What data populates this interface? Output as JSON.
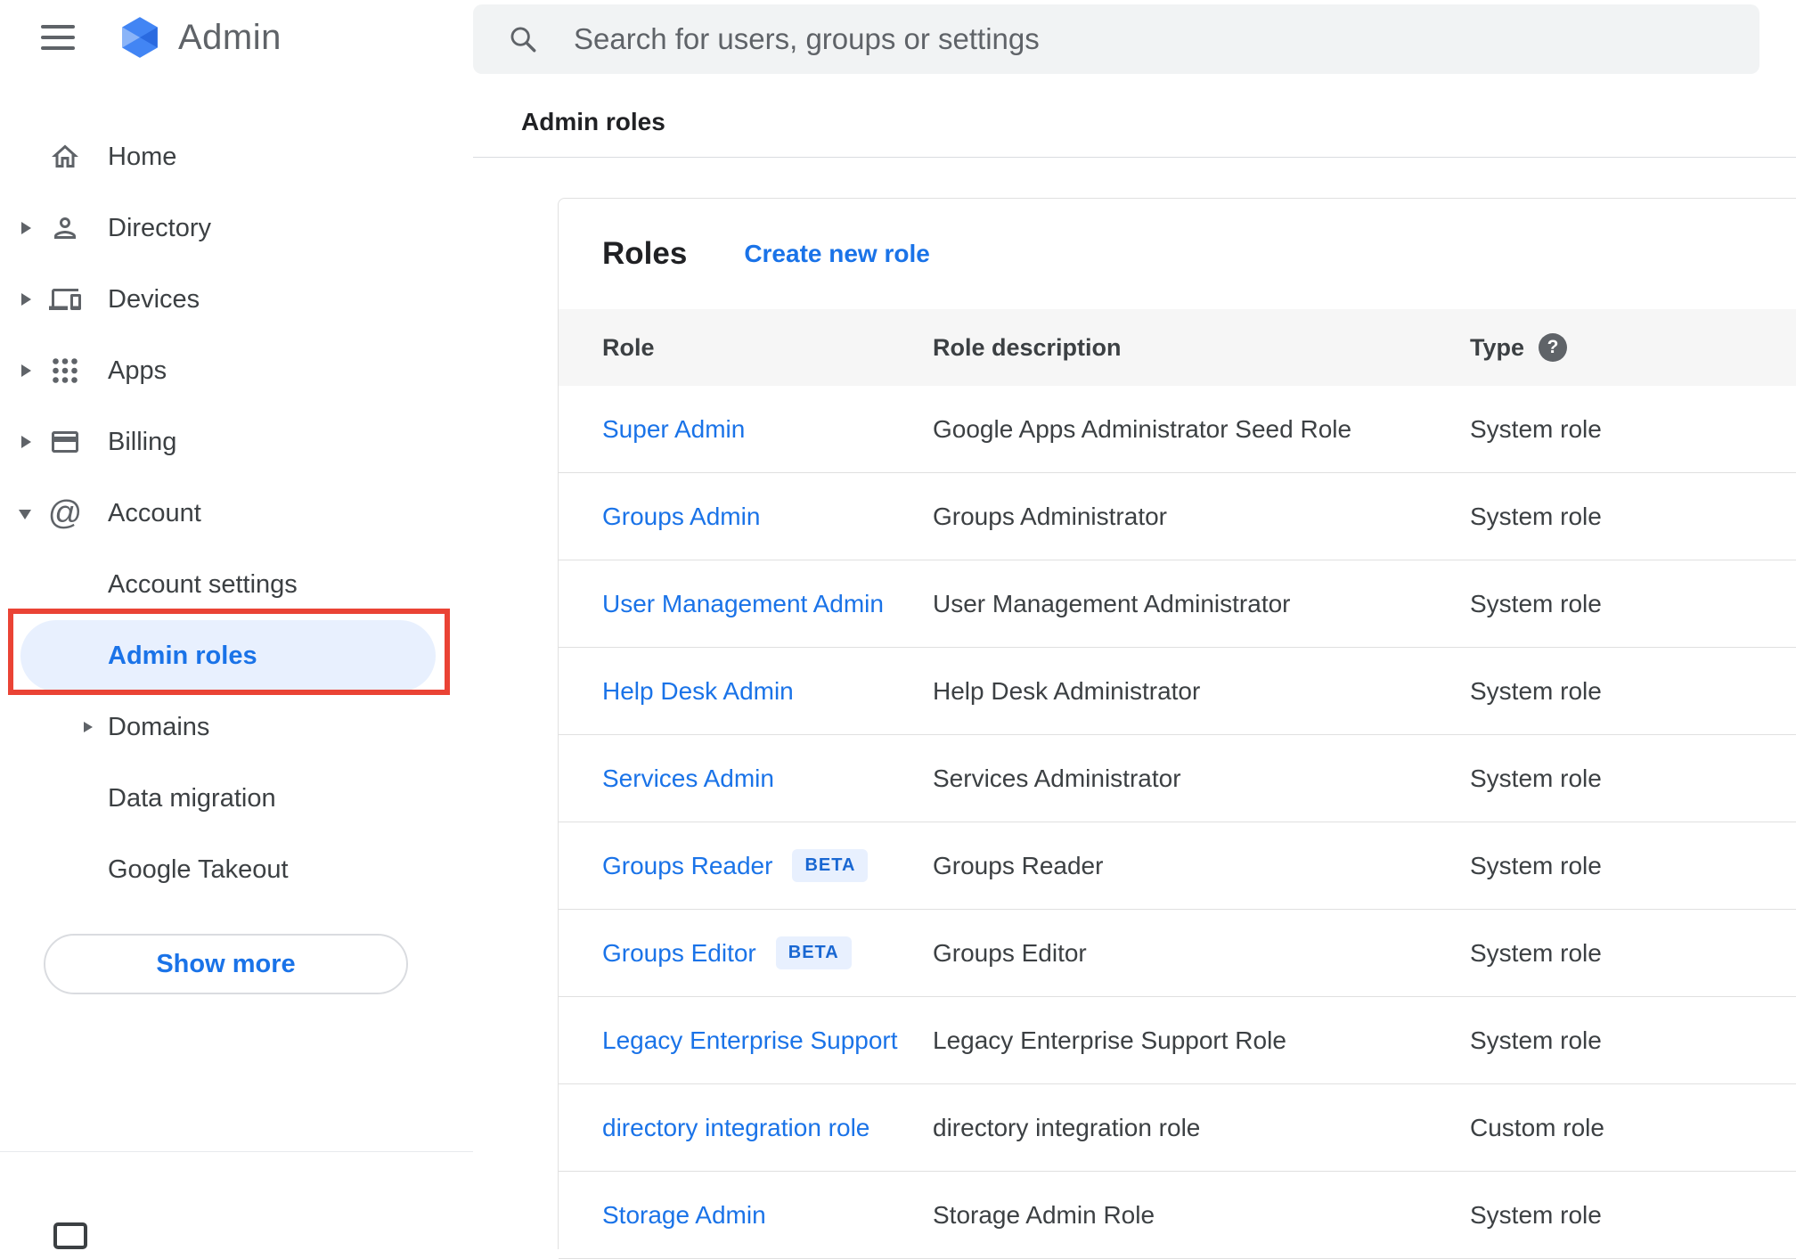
{
  "app": {
    "title": "Admin"
  },
  "search": {
    "placeholder": "Search for users, groups or settings"
  },
  "breadcrumb": "Admin roles",
  "icons": {
    "at_glyph": "@",
    "help_glyph": "?"
  },
  "colors": {
    "accent_blue": "#1a73e8",
    "annotation_red": "#ea4335",
    "selected_item_bg": "#e8f0fe",
    "beta_badge_bg": "#e8f0fe",
    "beta_badge_text": "#1967d2",
    "search_bar_bg": "#f1f3f4",
    "table_header_bg": "#f6f6f6",
    "divider": "#e0e0e0",
    "icon_gray": "#5f6368"
  },
  "sidebar": {
    "items": [
      {
        "label": "Home",
        "icon": "home-icon",
        "expandable": false
      },
      {
        "label": "Directory",
        "icon": "person-icon",
        "expandable": true
      },
      {
        "label": "Devices",
        "icon": "devices-icon",
        "expandable": true
      },
      {
        "label": "Apps",
        "icon": "apps-grid-icon",
        "expandable": true
      },
      {
        "label": "Billing",
        "icon": "credit-card-icon",
        "expandable": true
      },
      {
        "label": "Account",
        "icon": "at-icon",
        "expandable": true,
        "expanded": true
      }
    ],
    "account_subitems": [
      {
        "label": "Account settings",
        "selected": false
      },
      {
        "label": "Admin roles",
        "selected": true
      },
      {
        "label": "Domains",
        "selected": false,
        "expandable": true
      },
      {
        "label": "Data migration",
        "selected": false
      },
      {
        "label": "Google Takeout",
        "selected": false
      }
    ],
    "show_more_label": "Show more"
  },
  "main": {
    "card": {
      "title": "Roles",
      "create_link": "Create new role",
      "table": {
        "headers": {
          "role": "Role",
          "description": "Role description",
          "type": "Type"
        },
        "beta_label": "BETA",
        "rows": [
          {
            "role": "Super Admin",
            "description": "Google Apps Administrator Seed Role",
            "type": "System role",
            "beta": false
          },
          {
            "role": "Groups Admin",
            "description": "Groups Administrator",
            "type": "System role",
            "beta": false
          },
          {
            "role": "User Management Admin",
            "description": "User Management Administrator",
            "type": "System role",
            "beta": false
          },
          {
            "role": "Help Desk Admin",
            "description": "Help Desk Administrator",
            "type": "System role",
            "beta": false
          },
          {
            "role": "Services Admin",
            "description": "Services Administrator",
            "type": "System role",
            "beta": false
          },
          {
            "role": "Groups Reader",
            "description": "Groups Reader",
            "type": "System role",
            "beta": true
          },
          {
            "role": "Groups Editor",
            "description": "Groups Editor",
            "type": "System role",
            "beta": true
          },
          {
            "role": "Legacy Enterprise Support",
            "description": "Legacy Enterprise Support Role",
            "type": "System role",
            "beta": false
          },
          {
            "role": "directory integration role",
            "description": "directory integration role",
            "type": "Custom role",
            "beta": false
          },
          {
            "role": "Storage Admin",
            "description": "Storage Admin Role",
            "type": "System role",
            "beta": false
          }
        ]
      }
    }
  }
}
